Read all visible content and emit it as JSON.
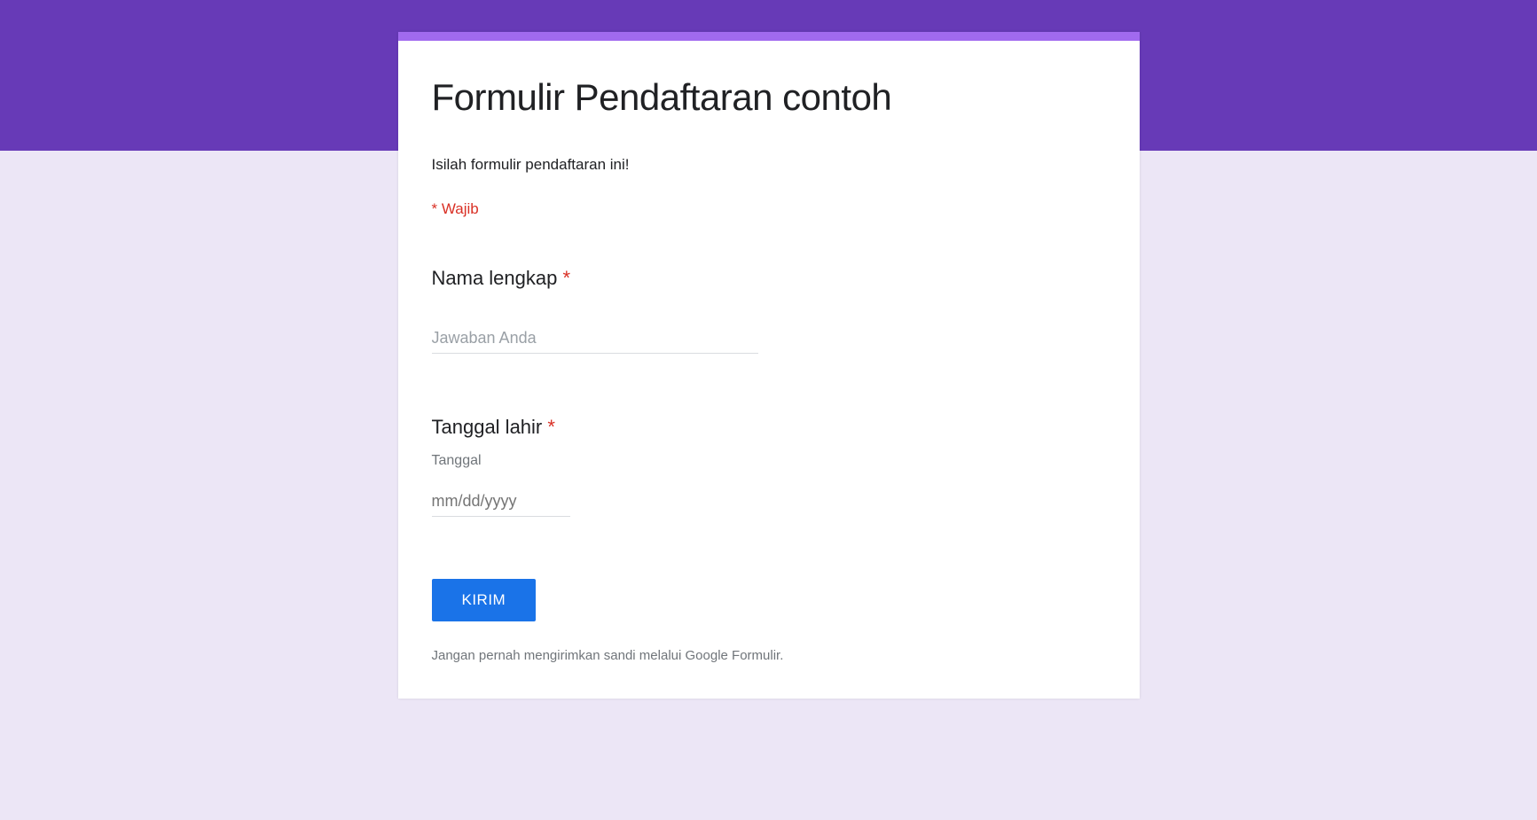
{
  "form": {
    "title": "Formulir Pendaftaran contoh",
    "description": "Isilah formulir pendaftaran ini!",
    "required_note": "* Wajib",
    "questions": {
      "name": {
        "label": "Nama lengkap ",
        "placeholder": "Jawaban Anda"
      },
      "birthdate": {
        "label": "Tanggal lahir ",
        "sublabel": "Tanggal",
        "placeholder": "mm/dd/yyyy"
      }
    },
    "submit_label": "KIRIM",
    "disclaimer": "Jangan pernah mengirimkan sandi melalui Google Formulir.",
    "required_asterisk": "*"
  }
}
